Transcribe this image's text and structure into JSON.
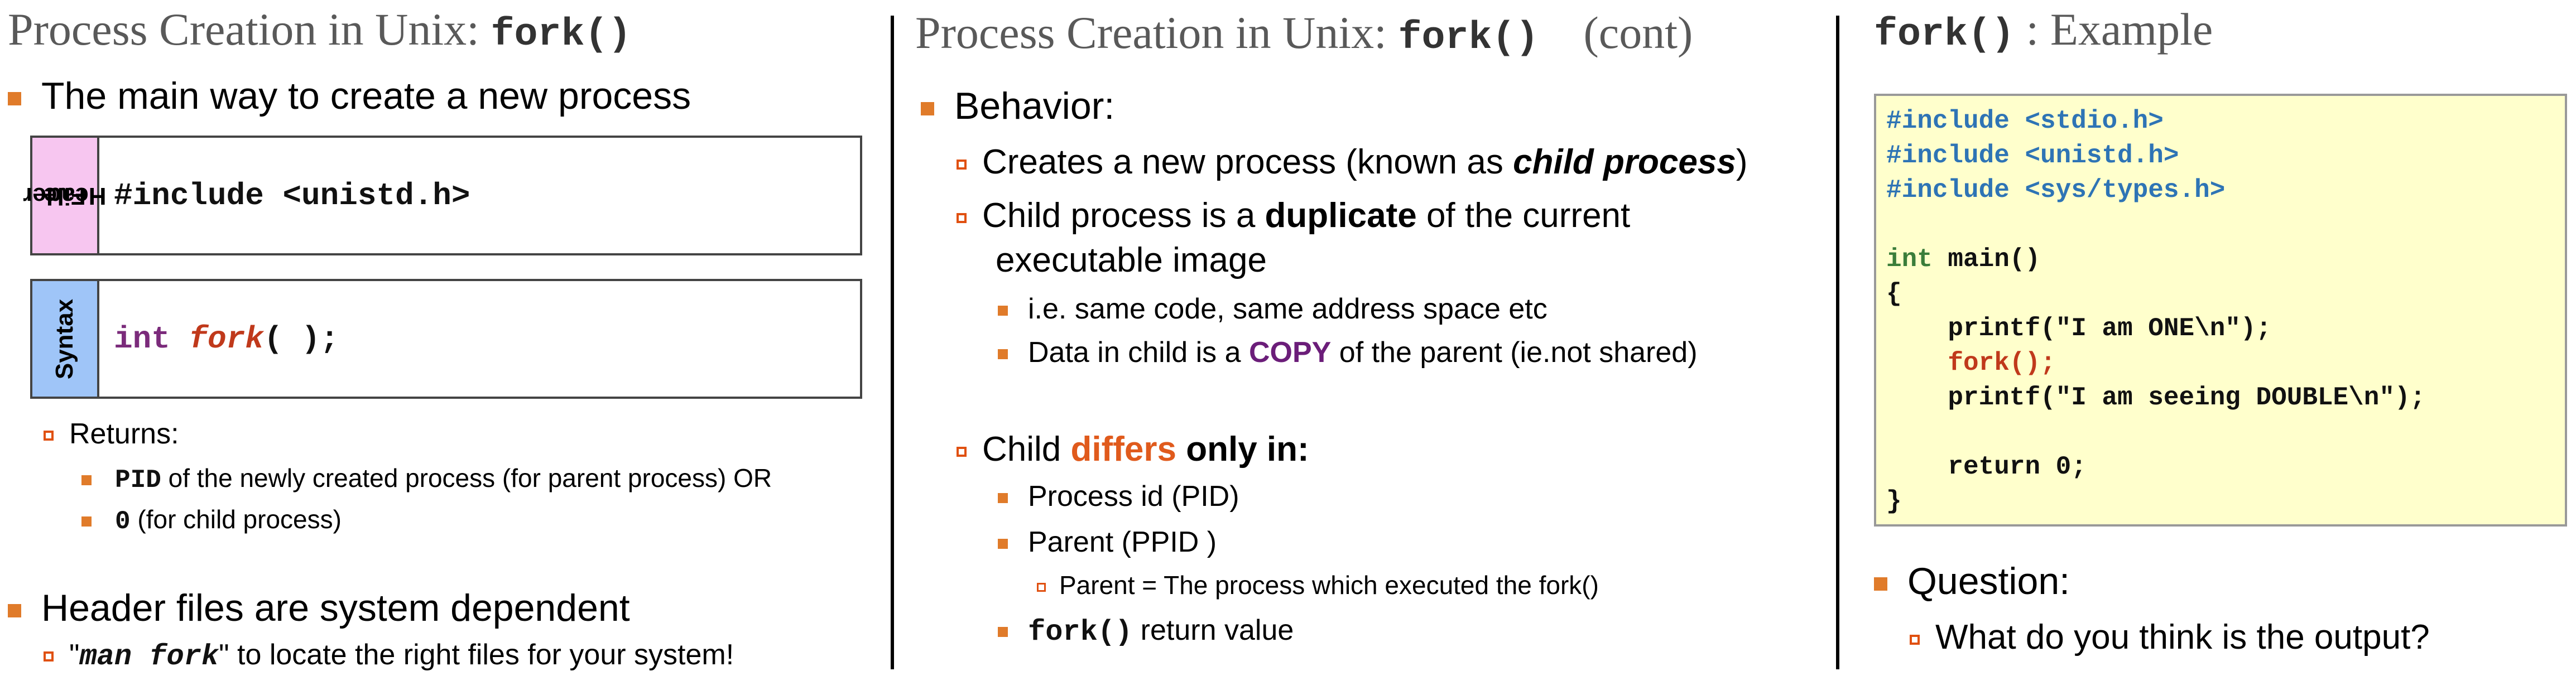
{
  "slides": [
    {
      "title_text": "Process Creation in Unix: ",
      "title_code": "fork()",
      "bullet_main": "The main way to create a new process",
      "header_box": {
        "tab_line1": "Header",
        "tab_line2": "File",
        "code": "#include <unistd.h>"
      },
      "syntax_box": {
        "tab": "Syntax",
        "kw": "int",
        "fn": "fork",
        "rest": "( );"
      },
      "returns_label": "Returns:",
      "returns_items": [
        {
          "code": "PID",
          "text": " of the newly created process (for parent process) OR"
        },
        {
          "code": "0",
          "text": " (for child process)"
        }
      ],
      "bullet_header_files": "Header files are system dependent",
      "man_pre": "\"",
      "man_code": "man fork",
      "man_post": "\" to locate the right files for your system!"
    },
    {
      "title_text": "Process Creation in Unix: ",
      "title_code": "fork()",
      "title_suffix": "(cont)",
      "behavior": "Behavior:",
      "item1_pre": "Creates a new process (known as ",
      "item1_em": "child process",
      "item1_post": ")",
      "item2_pre": "Child process is a ",
      "item2_b": "duplicate",
      "item2_post": " of the current",
      "item2_line2": "executable image",
      "sub1": "i.e. same code, same address space etc",
      "sub2_pre": "Data in child is a ",
      "sub2_copy": "COPY",
      "sub2_post": " of the parent (ie.not shared)",
      "differs_pre": "Child ",
      "differs_red": "differs",
      "differs_post": " only in:",
      "diff1": "Process id (PID)",
      "diff2": "Parent (PPID )",
      "diff2_sub": "Parent = The process which executed the fork()",
      "diff3_code": "fork()",
      "diff3_text": " return value"
    },
    {
      "title_code": "fork()",
      "title_text": " : Example",
      "code_lines": [
        "#include <stdio.h>",
        "#include <unistd.h>",
        "#include <sys/types.h>",
        "",
        "int main()",
        "{",
        "    printf(\"I am ONE\\n\");",
        "    fork();",
        "    printf(\"I am seeing DOUBLE\\n\");",
        "",
        "    return 0;",
        "}"
      ],
      "question": "Question:",
      "question_sub": "What do you think is the output?"
    }
  ],
  "colors": {
    "accent_bullet": "#e07b2a",
    "tab_header": "#f7c6f0",
    "tab_syntax": "#9fc5f8",
    "keyword_purple": "#7b2b7b",
    "fork_red": "#c0391b",
    "copy_purple": "#6b1d79",
    "differs_orange": "#e05a1c",
    "include_blue": "#2e74b5",
    "int_green": "#3a7d3a",
    "code_bg": "#ffffcc"
  },
  "icons": {
    "level1": "orange-square-bullet",
    "level2": "hollow-square-bullet"
  }
}
